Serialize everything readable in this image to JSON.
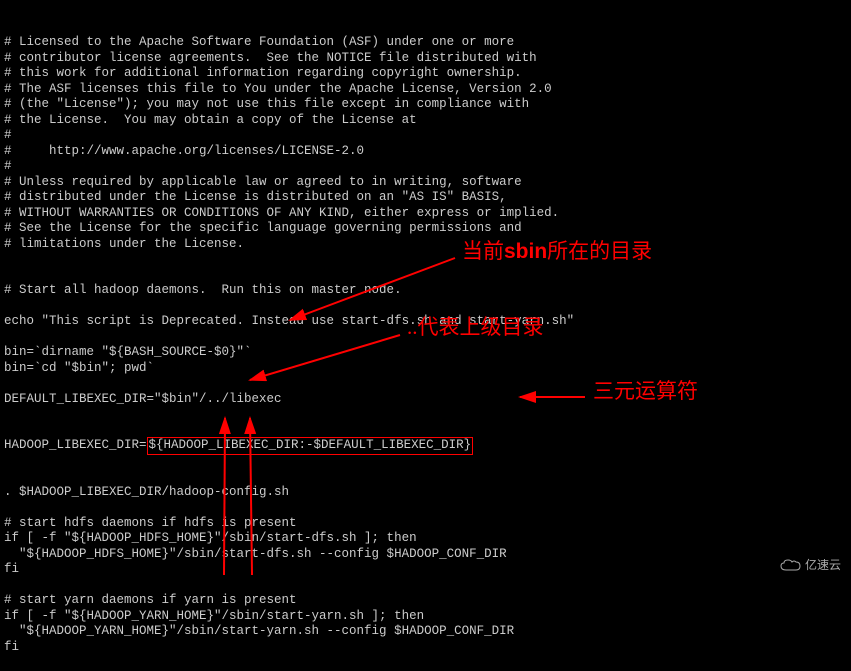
{
  "code": {
    "lines": [
      "# Licensed to the Apache Software Foundation (ASF) under one or more",
      "# contributor license agreements.  See the NOTICE file distributed with",
      "# this work for additional information regarding copyright ownership.",
      "# The ASF licenses this file to You under the Apache License, Version 2.0",
      "# (the \"License\"); you may not use this file except in compliance with",
      "# the License.  You may obtain a copy of the License at",
      "#",
      "#     http://www.apache.org/licenses/LICENSE-2.0",
      "#",
      "# Unless required by applicable law or agreed to in writing, software",
      "# distributed under the License is distributed on an \"AS IS\" BASIS,",
      "# WITHOUT WARRANTIES OR CONDITIONS OF ANY KIND, either express or implied.",
      "# See the License for the specific language governing permissions and",
      "# limitations under the License.",
      "",
      "",
      "# Start all hadoop daemons.  Run this on master node.",
      "",
      "echo \"This script is Deprecated. Instead use start-dfs.sh and start-yarn.sh\"",
      "",
      "bin=`dirname \"${BASH_SOURCE-$0}\"`",
      "bin=`cd \"$bin\"; pwd`",
      "",
      "DEFAULT_LIBEXEC_DIR=\"$bin\"/../libexec"
    ],
    "highlight_prefix": "HADOOP_LIBEXEC_DIR=",
    "highlight_content": "${HADOOP_LIBEXEC_DIR:-$DEFAULT_LIBEXEC_DIR}",
    "lines_after": [
      ". $HADOOP_LIBEXEC_DIR/hadoop-config.sh",
      "",
      "# start hdfs daemons if hdfs is present",
      "if [ -f \"${HADOOP_HDFS_HOME}\"/sbin/start-dfs.sh ]; then",
      "  \"${HADOOP_HDFS_HOME}\"/sbin/start-dfs.sh --config $HADOOP_CONF_DIR",
      "fi",
      "",
      "# start yarn daemons if yarn is present",
      "if [ -f \"${HADOOP_YARN_HOME}\"/sbin/start-yarn.sh ]; then",
      "  \"${HADOOP_YARN_HOME}\"/sbin/start-yarn.sh --config $HADOOP_CONF_DIR",
      "fi"
    ]
  },
  "annotations": {
    "sbin": {
      "prefix": "当前",
      "en": "sbin",
      "suffix": "所在的目录"
    },
    "dotdot": "..代表上级目录",
    "ternary": "三元运算符"
  },
  "watermark": {
    "text": "亿速云"
  },
  "colors": {
    "accent": "#ff0000",
    "text": "#cccccc",
    "bg": "#000000"
  }
}
